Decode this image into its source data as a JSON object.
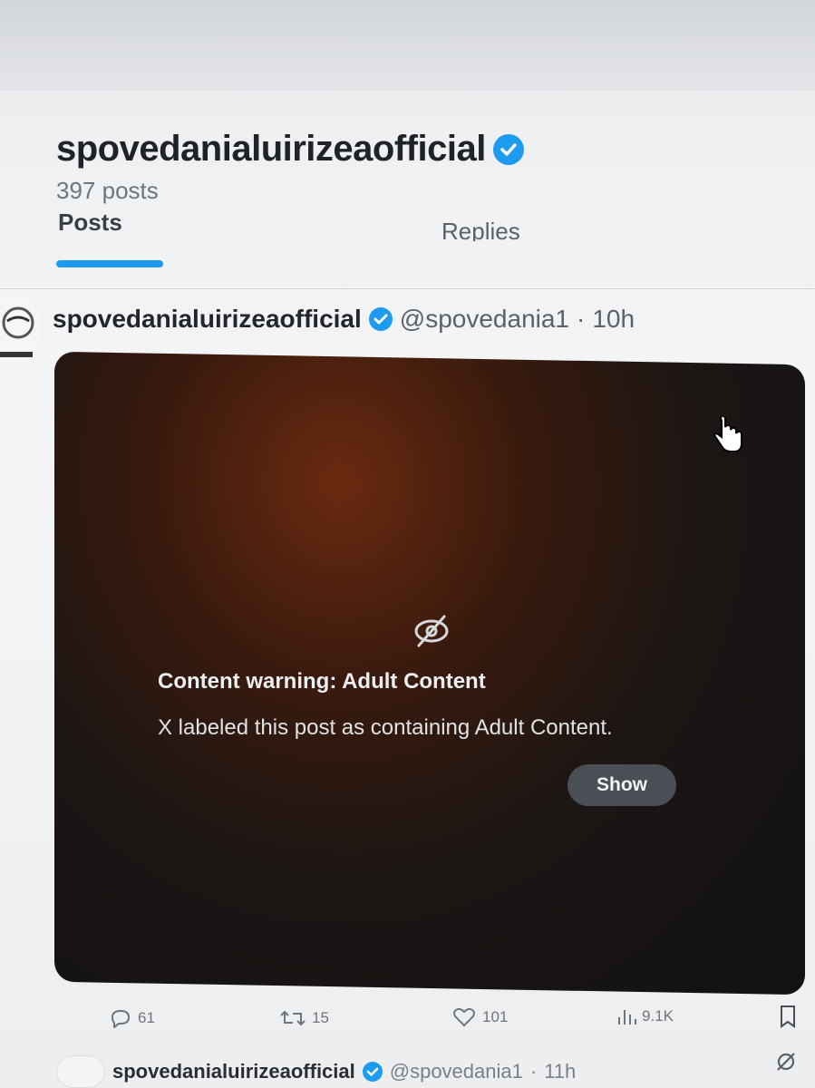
{
  "profile": {
    "display_name": "spovedanialuirizeaofficial",
    "post_count": "397 posts",
    "verified": true
  },
  "tabs": [
    {
      "label": "Posts",
      "active": true
    },
    {
      "label": "Replies",
      "active": false
    }
  ],
  "post": {
    "display_name": "spovedanialuirizeaofficial",
    "handle": "@spovedania1",
    "separator": "·",
    "time": "10h",
    "content_warning": {
      "title": "Content warning: Adult Content",
      "text": "X labeled this post as containing Adult Content.",
      "show_label": "Show"
    },
    "actions": {
      "replies": "61",
      "reposts": "15",
      "likes": "101",
      "views": "9.1K"
    }
  },
  "next_post": {
    "display_name": "spovedanialuirizeaofficial",
    "handle": "@spovedania1",
    "separator": "·",
    "time": "11h"
  },
  "colors": {
    "accent": "#1d9bf0",
    "media_bg": "#121212",
    "text_primary": "#1f2328"
  },
  "icons": [
    "verified-badge-icon",
    "eye-slash-icon",
    "hand-cursor-icon",
    "reply-icon",
    "repost-icon",
    "like-icon",
    "views-icon",
    "bookmark-icon",
    "grok-icon"
  ]
}
